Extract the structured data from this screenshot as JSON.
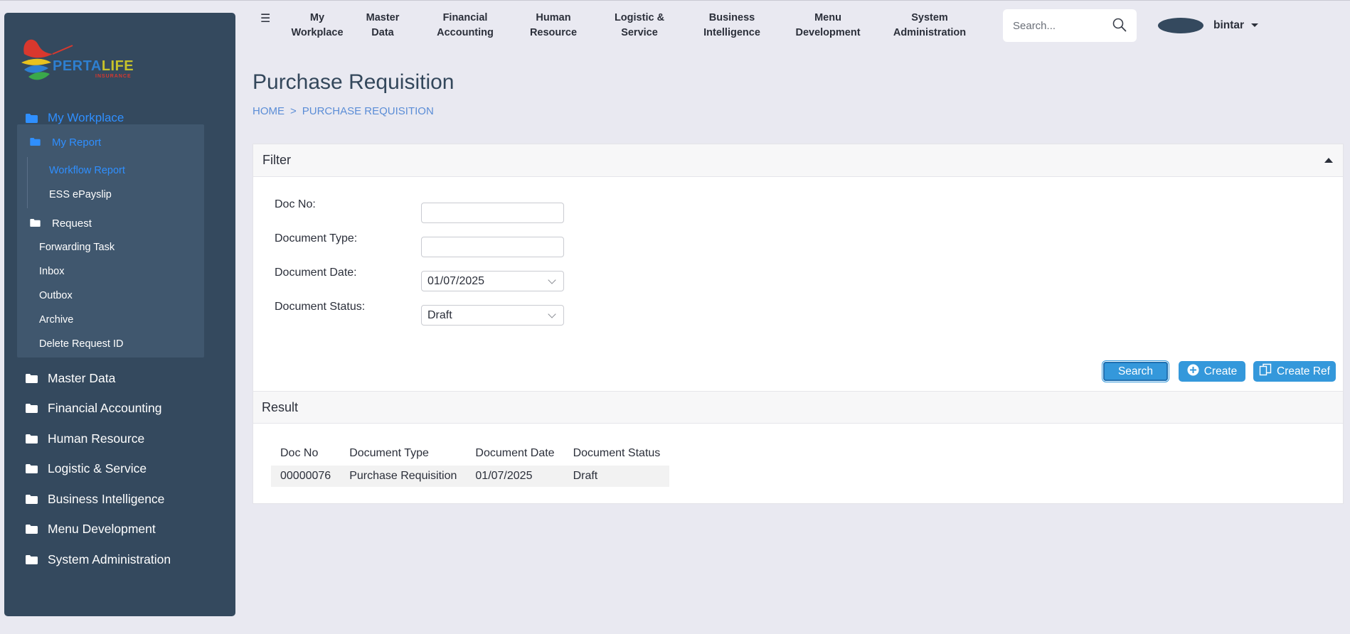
{
  "brand": {
    "logo_word_a": "PERTA",
    "logo_word_b": "LIFE",
    "logo_sub": "INSURANCE"
  },
  "topnav": {
    "items": [
      "My\nWorkplace",
      "Master\nData",
      "Financial\nAccounting",
      "Human\nResource",
      "Logistic &\nService",
      "Business\nIntelligence",
      "Menu\nDevelopment",
      "System\nAdministration"
    ],
    "search_placeholder": "Search...",
    "username": "bintar"
  },
  "sidebar": {
    "top": "My Workplace",
    "submenu": {
      "my_report": "My Report",
      "workflow_report": "Workflow Report",
      "ess_epayslip": "ESS ePayslip",
      "request": "Request",
      "forwarding_task": "Forwarding Task",
      "inbox": "Inbox",
      "outbox": "Outbox",
      "archive": "Archive",
      "delete_request_id": "Delete Request ID"
    },
    "items": [
      "Master Data",
      "Financial Accounting",
      "Human Resource",
      "Logistic & Service",
      "Business Intelligence",
      "Menu Development",
      "System Administration"
    ]
  },
  "page": {
    "title": "Purchase Requisition",
    "breadcrumb": [
      "HOME",
      ">",
      "PURCHASE REQUISITION"
    ]
  },
  "filter": {
    "title": "Filter",
    "doc_no_label": "Doc No:",
    "doc_no_value": "",
    "doc_type_label": "Document Type:",
    "doc_type_value": "",
    "doc_date_label": "Document Date:",
    "doc_date_value": "01/07/2025",
    "doc_status_label": "Document Status:",
    "doc_status_value": "Draft",
    "search_btn": "Search",
    "create_btn": "Create",
    "create_ref_btn": "Create Ref"
  },
  "result": {
    "title": "Result",
    "columns": [
      "Doc No",
      "Document Type",
      "Document Date",
      "Document Status"
    ],
    "rows": [
      [
        "00000076",
        "Purchase Requisition",
        "01/07/2025",
        "Draft"
      ]
    ]
  },
  "colors": {
    "sidebar_bg": "#34495e",
    "accent": "#3498db",
    "link": "#2f8fff",
    "page_bg": "#e9e9f1"
  }
}
